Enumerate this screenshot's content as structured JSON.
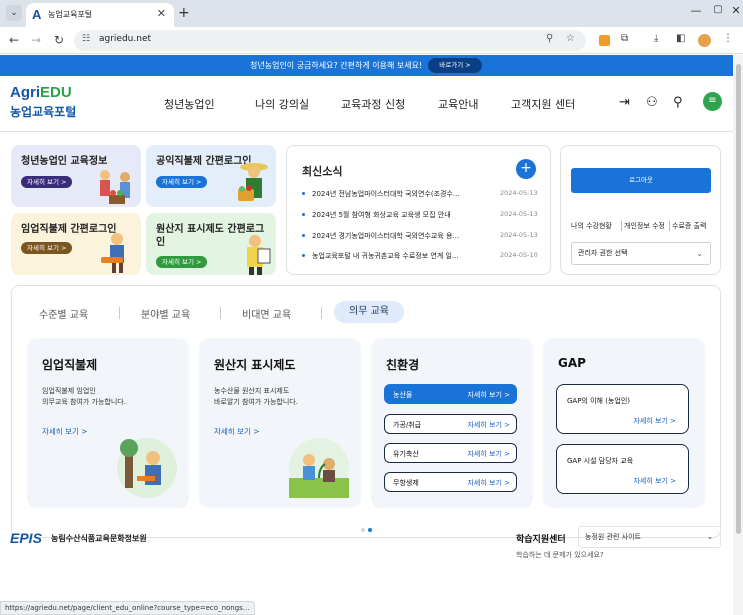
{
  "browser": {
    "tab_title": "농업교육포털",
    "tab_favicon": "A",
    "url": "agriedu.net",
    "status_url": "https://agriedu.net/page/client_edu_online?course_type=eco_nongs..."
  },
  "banner": {
    "text": "청년농업인이 궁금하세요? 간편하게 이용해 보세요!",
    "button": "바로가기 >"
  },
  "header": {
    "logo_agri": "Agri",
    "logo_edu": "EDU",
    "logo_sub": "농업교육포털",
    "nav": [
      "청년농업인",
      "나의 강의실",
      "교육과정 신청",
      "교육안내",
      "고객지원 센터"
    ]
  },
  "quick_cards": [
    {
      "title": "청년농업인 교육정보",
      "more": "자세히 보기 >",
      "bg": "#e6e9f7",
      "pill": "#3a2c7a"
    },
    {
      "title": "공익직불제 간편로그인",
      "more": "자세히 보기 >",
      "bg": "#e4eefb",
      "pill": "#1a73d6"
    },
    {
      "title": "임업직불제 간편로그인",
      "more": "자세히 보기 >",
      "bg": "#fcf3dc",
      "pill": "#7a5520"
    },
    {
      "title": "원산지 표시제도 간편로그인",
      "more": "자세히 보기 >",
      "bg": "#e3f4e3",
      "pill": "#2f9a3e"
    }
  ],
  "news": {
    "title": "최신소식",
    "items": [
      {
        "text": "2024년 전남농업마이스터대학 국외연수(조경수...",
        "date": "2024-05-13"
      },
      {
        "text": "2024년 5월 참여형 화상교육 교육생 모집 안내",
        "date": "2024-05-13"
      },
      {
        "text": "2024년 경기농업마이스터대학 국외연수교육 용...",
        "date": "2024-05-13"
      },
      {
        "text": "농업교육포털 내 귀농귀촌교육 수료정보 연계 일...",
        "date": "2024-05-10"
      }
    ]
  },
  "login": {
    "logout": "로그아웃",
    "links": [
      "나의 수강현황",
      "개인정보 수정",
      "수료증 출력"
    ],
    "admin_select": "관리자 권한 선택"
  },
  "edu": {
    "tabs": [
      "수준별 교육",
      "분야별 교육",
      "비대면 교육",
      "의무 교육"
    ],
    "active_tab": "의무 교육",
    "panels": {
      "forest": {
        "title": "임업직불제",
        "desc1": "임업직불제 임업인",
        "desc2": "의무교육 참여가 가능합니다.",
        "more": "자세히 보기 >"
      },
      "origin": {
        "title": "원산지 표시제도",
        "desc1": "농수산물 원산지 표시제도",
        "desc2": "바로알기 참여가 가능합니다.",
        "more": "자세히 보기 >"
      },
      "eco": {
        "title": "친환경",
        "options": [
          {
            "label": "농산물",
            "more": "자세히 보기 >",
            "active": true
          },
          {
            "label": "가공/취급",
            "more": "자세히 보기 >",
            "active": false
          },
          {
            "label": "유기축산",
            "more": "자세히 보기 >",
            "active": false
          },
          {
            "label": "무항생제",
            "more": "자세히 보기 >",
            "active": false
          }
        ]
      },
      "gap": {
        "title": "GAP",
        "boxes": [
          {
            "label": "GAP의 이해 (농업인)",
            "more": "자세히 보기 >"
          },
          {
            "label": "GAP 시설 담당자 교육",
            "more": "자세히 보기 >"
          }
        ]
      }
    }
  },
  "footer": {
    "logo": "EPIS",
    "org": "농림수산식품교육문화정보원",
    "center": "학습지원센터",
    "select": "농정원 관련 사이트",
    "question": "학습하는 데 문제가 있으세요?"
  }
}
